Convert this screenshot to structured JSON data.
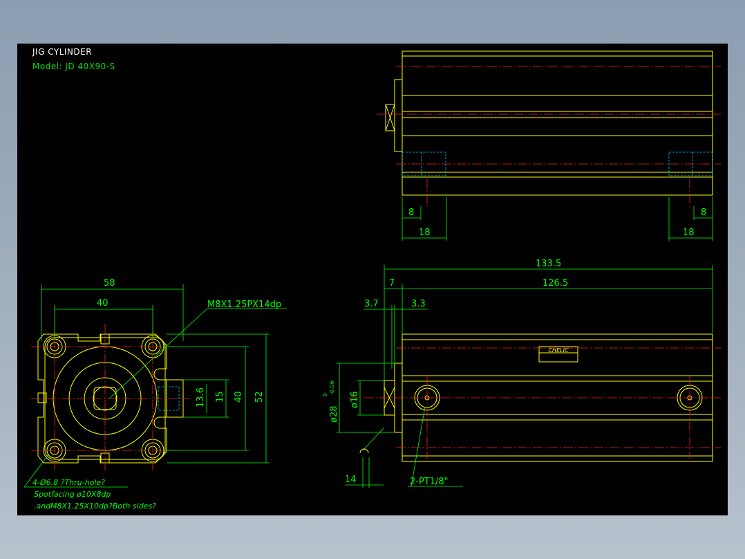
{
  "drawing": {
    "title": "JIG CYLINDER",
    "model": "Model:  JD  40X90-S",
    "brand_plate": "CHELIC"
  },
  "dimensions": {
    "front_width_58": "58",
    "front_width_40": "40",
    "front_height_52": "52",
    "front_height_40": "40",
    "port_15": "15",
    "port_13_6": "13.6",
    "thread_callout": "M8X1.25PX14dp",
    "side_overall": "133.5",
    "side_body": "126.5",
    "side_7": "7",
    "side_3_7": "3.7",
    "side_3_3": "3.3",
    "rod_dia_16": "ø16",
    "flange_dia": "ø28",
    "flange_tol_upper": "0",
    "flange_tol_lower": "-0.06",
    "rod_end_14": "14",
    "port_callout": "2-PT1/8\"",
    "top_left_8": "8",
    "top_left_18": "18",
    "top_right_8": "8",
    "top_right_18": "18"
  },
  "notes": {
    "line1": "4-Ø6.8  ?Thru-hole?",
    "line2": "Spotfacing  ø10X8dp",
    "line3": ".and",
    "line3b": "M8X1.25X10dp?Both sides?"
  },
  "colors": {
    "background": "#000000",
    "outline": "#ffff00",
    "dimension": "#00ff00",
    "centerline": "#ff2020",
    "hidden": "#00ccff"
  }
}
